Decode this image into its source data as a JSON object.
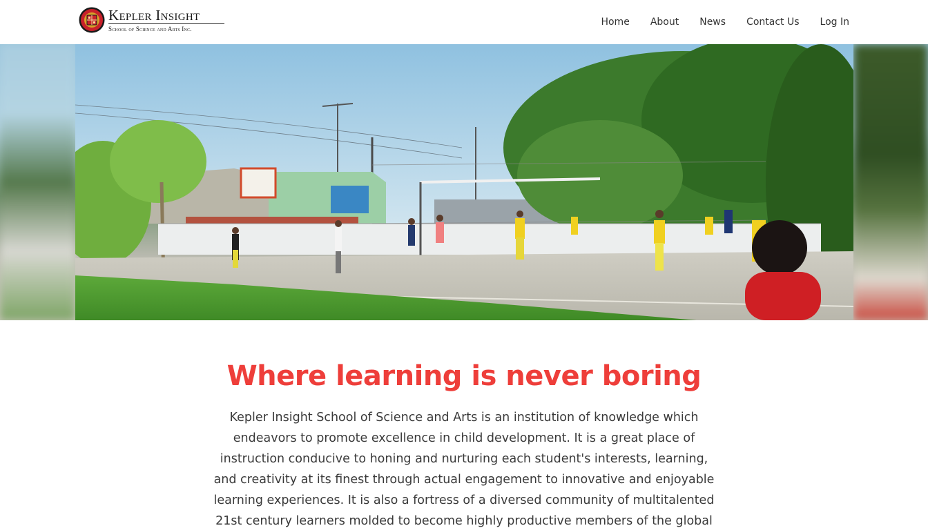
{
  "brand": {
    "title": "Kepler Insight",
    "subtitle": "School of Science and Arts Inc."
  },
  "nav": {
    "items": [
      {
        "label": "Home"
      },
      {
        "label": "About"
      },
      {
        "label": "News"
      },
      {
        "label": "Contact Us"
      },
      {
        "label": "Log In"
      }
    ]
  },
  "hero": {
    "image": "students-playing-volleyball-photo"
  },
  "main": {
    "headline": "Where learning is never boring",
    "intro": "Kepler Insight School of Science and Arts is an institution of knowledge which endeavors to promote excellence in child development. It is a great place of instruction conducive to honing and nurturing each student's interests, learning, and creativity at its finest through actual engagement to innovative and enjoyable learning experiences. It is also a fortress of a diversed community of multitalented 21st century learners molded to become highly productive members of the global"
  },
  "colors": {
    "accent": "#ee3e3a"
  }
}
